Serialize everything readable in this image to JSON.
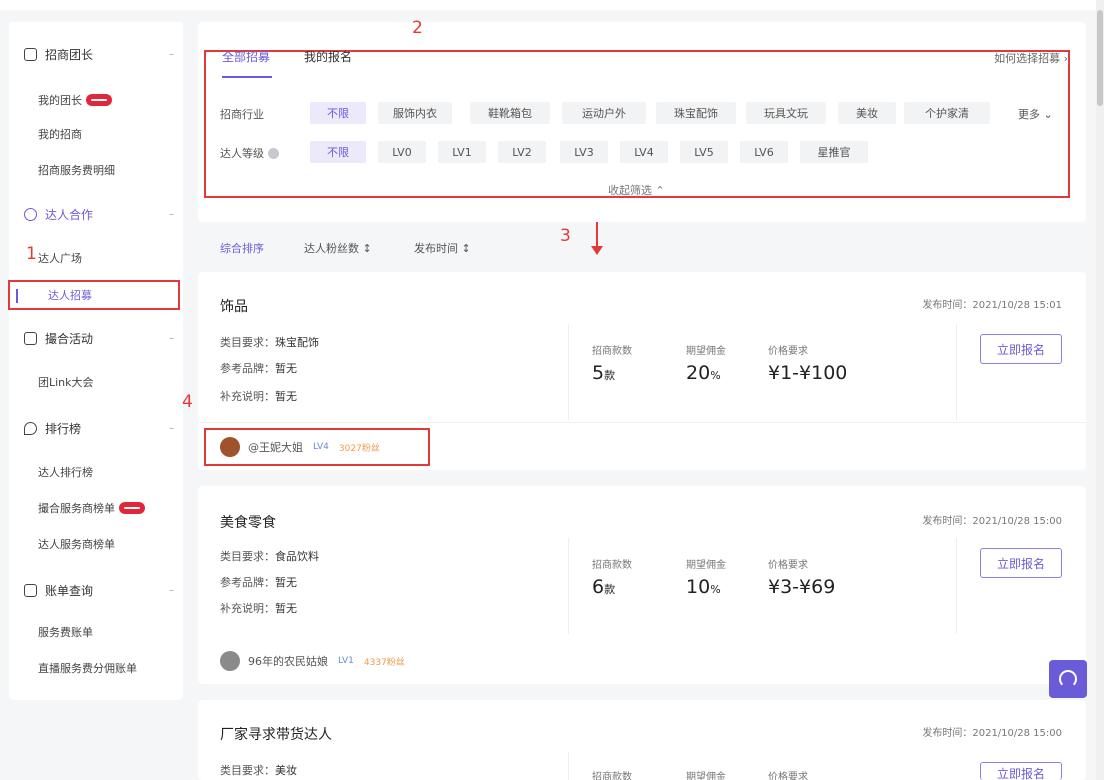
{
  "sidebar": {
    "groups": [
      {
        "title": "招商团长",
        "items": [
          {
            "label": "我的团长",
            "badge": true
          },
          {
            "label": "我的招商"
          },
          {
            "label": "招商服务费明细"
          }
        ]
      },
      {
        "title": "达人合作",
        "items": [
          {
            "label": "达人广场"
          },
          {
            "label": "达人招募"
          }
        ]
      },
      {
        "title": "撮合活动",
        "items": [
          {
            "label": "团Link大会"
          }
        ]
      },
      {
        "title": "排行榜",
        "items": [
          {
            "label": "达人排行榜"
          },
          {
            "label": "撮合服务商榜单",
            "badge": true
          },
          {
            "label": "达人服务商榜单"
          }
        ]
      },
      {
        "title": "账单查询",
        "items": [
          {
            "label": "服务费账单"
          },
          {
            "label": "直播服务费分佣账单"
          }
        ]
      }
    ]
  },
  "annotations": {
    "a1": "1",
    "a2": "2",
    "a3": "3",
    "a4": "4"
  },
  "filters": {
    "tabs": [
      "全部招募",
      "我的报名"
    ],
    "rule_link": "如何选择招募 ›",
    "category_label": "招商行业",
    "categories": [
      "不限",
      "服饰内衣",
      "鞋靴箱包",
      "运动户外",
      "珠宝配饰",
      "玩具文玩",
      "美妆",
      "个护家清"
    ],
    "more": "更多 ⌄",
    "level_label": "达人等级",
    "levels": [
      "不限",
      "LV0",
      "LV1",
      "LV2",
      "LV3",
      "LV4",
      "LV5",
      "LV6",
      "星推官"
    ],
    "collapse": "收起筛选 ⌃"
  },
  "sort": {
    "items": [
      "综合排序",
      "达人粉丝数 ↕",
      "发布时间 ↕"
    ]
  },
  "cards": [
    {
      "title": "饰品",
      "time": "发布时间：2021/10/28 15:01",
      "lines": [
        [
          "类目要求：",
          "珠宝配饰"
        ],
        [
          "参考品牌：",
          "暂无"
        ],
        [
          "补充说明：",
          "暂无"
        ]
      ],
      "stats": [
        {
          "label": "招商款数",
          "value": "5",
          "unit": "款"
        },
        {
          "label": "期望佣金",
          "value": "20",
          "unit": "%"
        },
        {
          "label": "价格要求",
          "value": "¥1-¥100",
          "unit": ""
        }
      ],
      "button": "立即报名",
      "creator": {
        "name": "@王妮大姐",
        "level": "LV4",
        "fans": "3027粉丝"
      }
    },
    {
      "title": "美食零食",
      "time": "发布时间：2021/10/28 15:00",
      "lines": [
        [
          "类目要求：",
          "食品饮料"
        ],
        [
          "参考品牌：",
          "暂无"
        ],
        [
          "补充说明：",
          "暂无"
        ]
      ],
      "stats": [
        {
          "label": "招商款数",
          "value": "6",
          "unit": "款"
        },
        {
          "label": "期望佣金",
          "value": "10",
          "unit": "%"
        },
        {
          "label": "价格要求",
          "value": "¥3-¥69",
          "unit": ""
        }
      ],
      "button": "立即报名",
      "creator": {
        "name": "96年的农民姑娘",
        "level": "LV1",
        "fans": "4337粉丝"
      }
    },
    {
      "title": "厂家寻求带货达人",
      "time": "发布时间：2021/10/28 15:00",
      "lines": [
        [
          "类目要求：",
          "美妆"
        ]
      ],
      "stats": [
        {
          "label": "招商款数"
        },
        {
          "label": "期望佣金"
        },
        {
          "label": "价格要求"
        }
      ],
      "button": "立即报名"
    }
  ]
}
